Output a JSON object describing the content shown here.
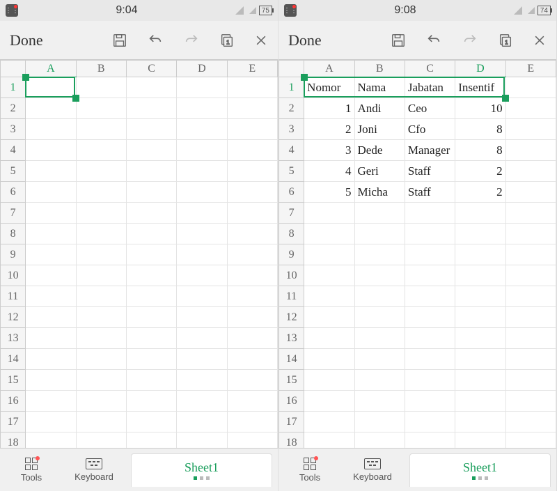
{
  "left": {
    "status": {
      "time": "9:04",
      "battery": "75"
    },
    "toolbar": {
      "done": "Done"
    },
    "columns": [
      "A",
      "B",
      "C",
      "D",
      "E"
    ],
    "rows": 19,
    "selectedCol": "A",
    "selectedRow": 1,
    "data": {}
  },
  "right": {
    "status": {
      "time": "9:08",
      "battery": "74"
    },
    "toolbar": {
      "done": "Done"
    },
    "columns": [
      "A",
      "B",
      "C",
      "D",
      "E"
    ],
    "rows": 18,
    "selectedCol": "D",
    "selectedRow": 1,
    "headers": {
      "A": "Nomor",
      "B": "Nama",
      "C": "Jabatan",
      "D": "Insentif"
    },
    "dataRows": [
      {
        "A": "1",
        "B": "Andi",
        "C": "Ceo",
        "D": "10"
      },
      {
        "A": "2",
        "B": "Joni",
        "C": "Cfo",
        "D": "8"
      },
      {
        "A": "3",
        "B": "Dede",
        "C": "Manager",
        "D": "8"
      },
      {
        "A": "4",
        "B": "Geri",
        "C": "Staff",
        "D": "2"
      },
      {
        "A": "5",
        "B": "Micha",
        "C": "Staff",
        "D": "2"
      }
    ]
  },
  "bottom": {
    "tools": "Tools",
    "keyboard": "Keyboard",
    "sheet": "Sheet1"
  }
}
